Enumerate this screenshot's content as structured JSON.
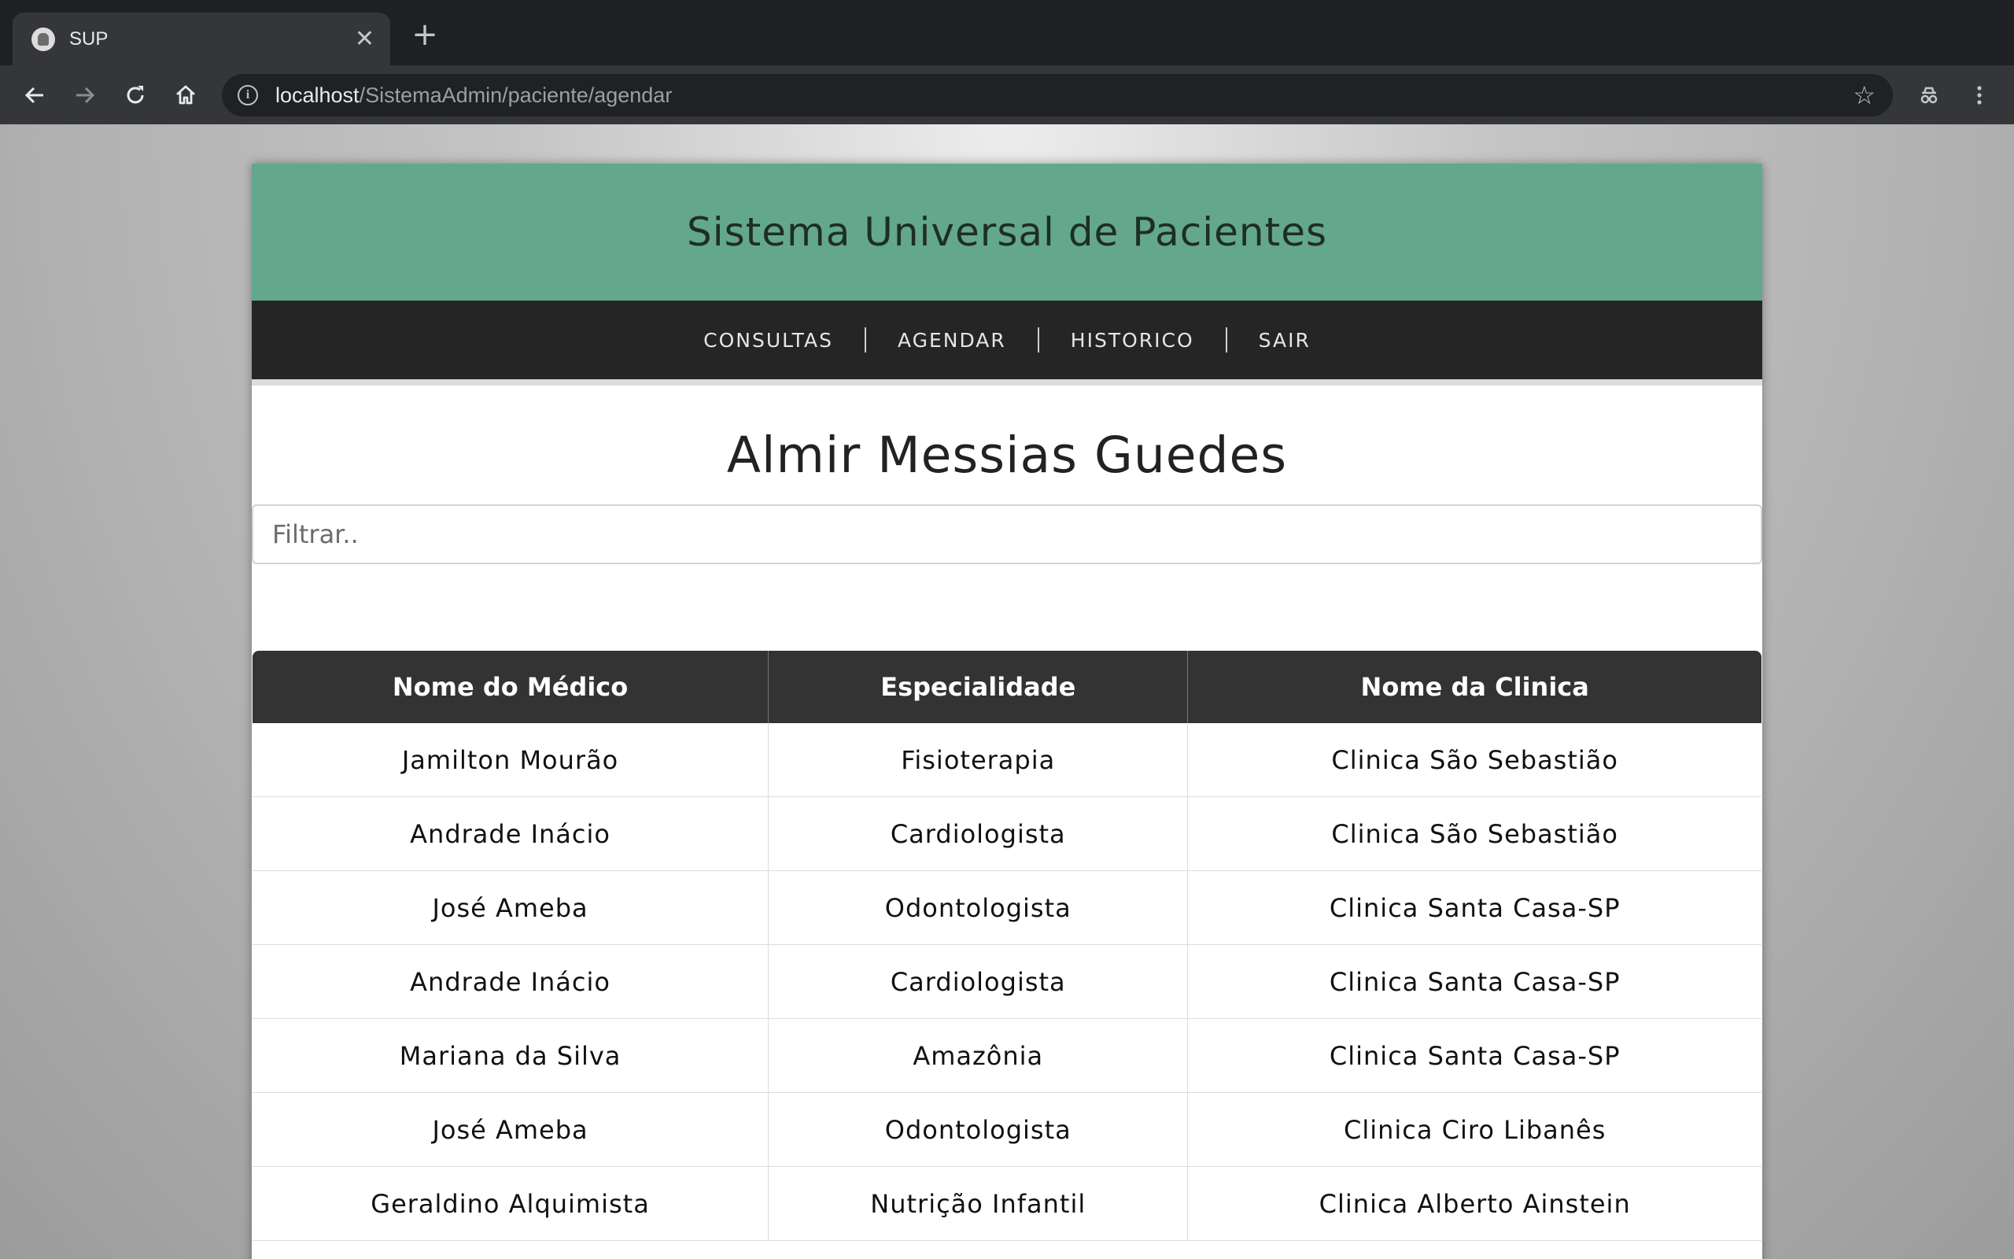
{
  "browser": {
    "tab_title": "SUP",
    "url_host": "localhost",
    "url_path": "/SistemaAdmin/paciente/agendar"
  },
  "site": {
    "title": "Sistema Universal de Pacientes",
    "nav": [
      "CONSULTAS",
      "AGENDAR",
      "HISTORICO",
      "SAIR"
    ],
    "header_color": "#63a88c",
    "nav_color": "#252525"
  },
  "main": {
    "patient_name": "Almir Messias Guedes",
    "filter_placeholder": "Filtrar..",
    "table": {
      "headers": [
        "Nome do Médico",
        "Especialidade",
        "Nome da Clinica"
      ],
      "rows": [
        [
          "Jamilton Mourão",
          "Fisioterapia",
          "Clinica São Sebastião"
        ],
        [
          "Andrade Inácio",
          "Cardiologista",
          "Clinica São Sebastião"
        ],
        [
          "José Ameba",
          "Odontologista",
          "Clinica Santa Casa-SP"
        ],
        [
          "Andrade Inácio",
          "Cardiologista",
          "Clinica Santa Casa-SP"
        ],
        [
          "Mariana da Silva",
          "Amazônia",
          "Clinica Santa Casa-SP"
        ],
        [
          "José Ameba",
          "Odontologista",
          "Clinica Ciro Libanês"
        ],
        [
          "Geraldino Alquimista",
          "Nutrição Infantil",
          "Clinica Alberto Ainstein"
        ]
      ]
    }
  }
}
